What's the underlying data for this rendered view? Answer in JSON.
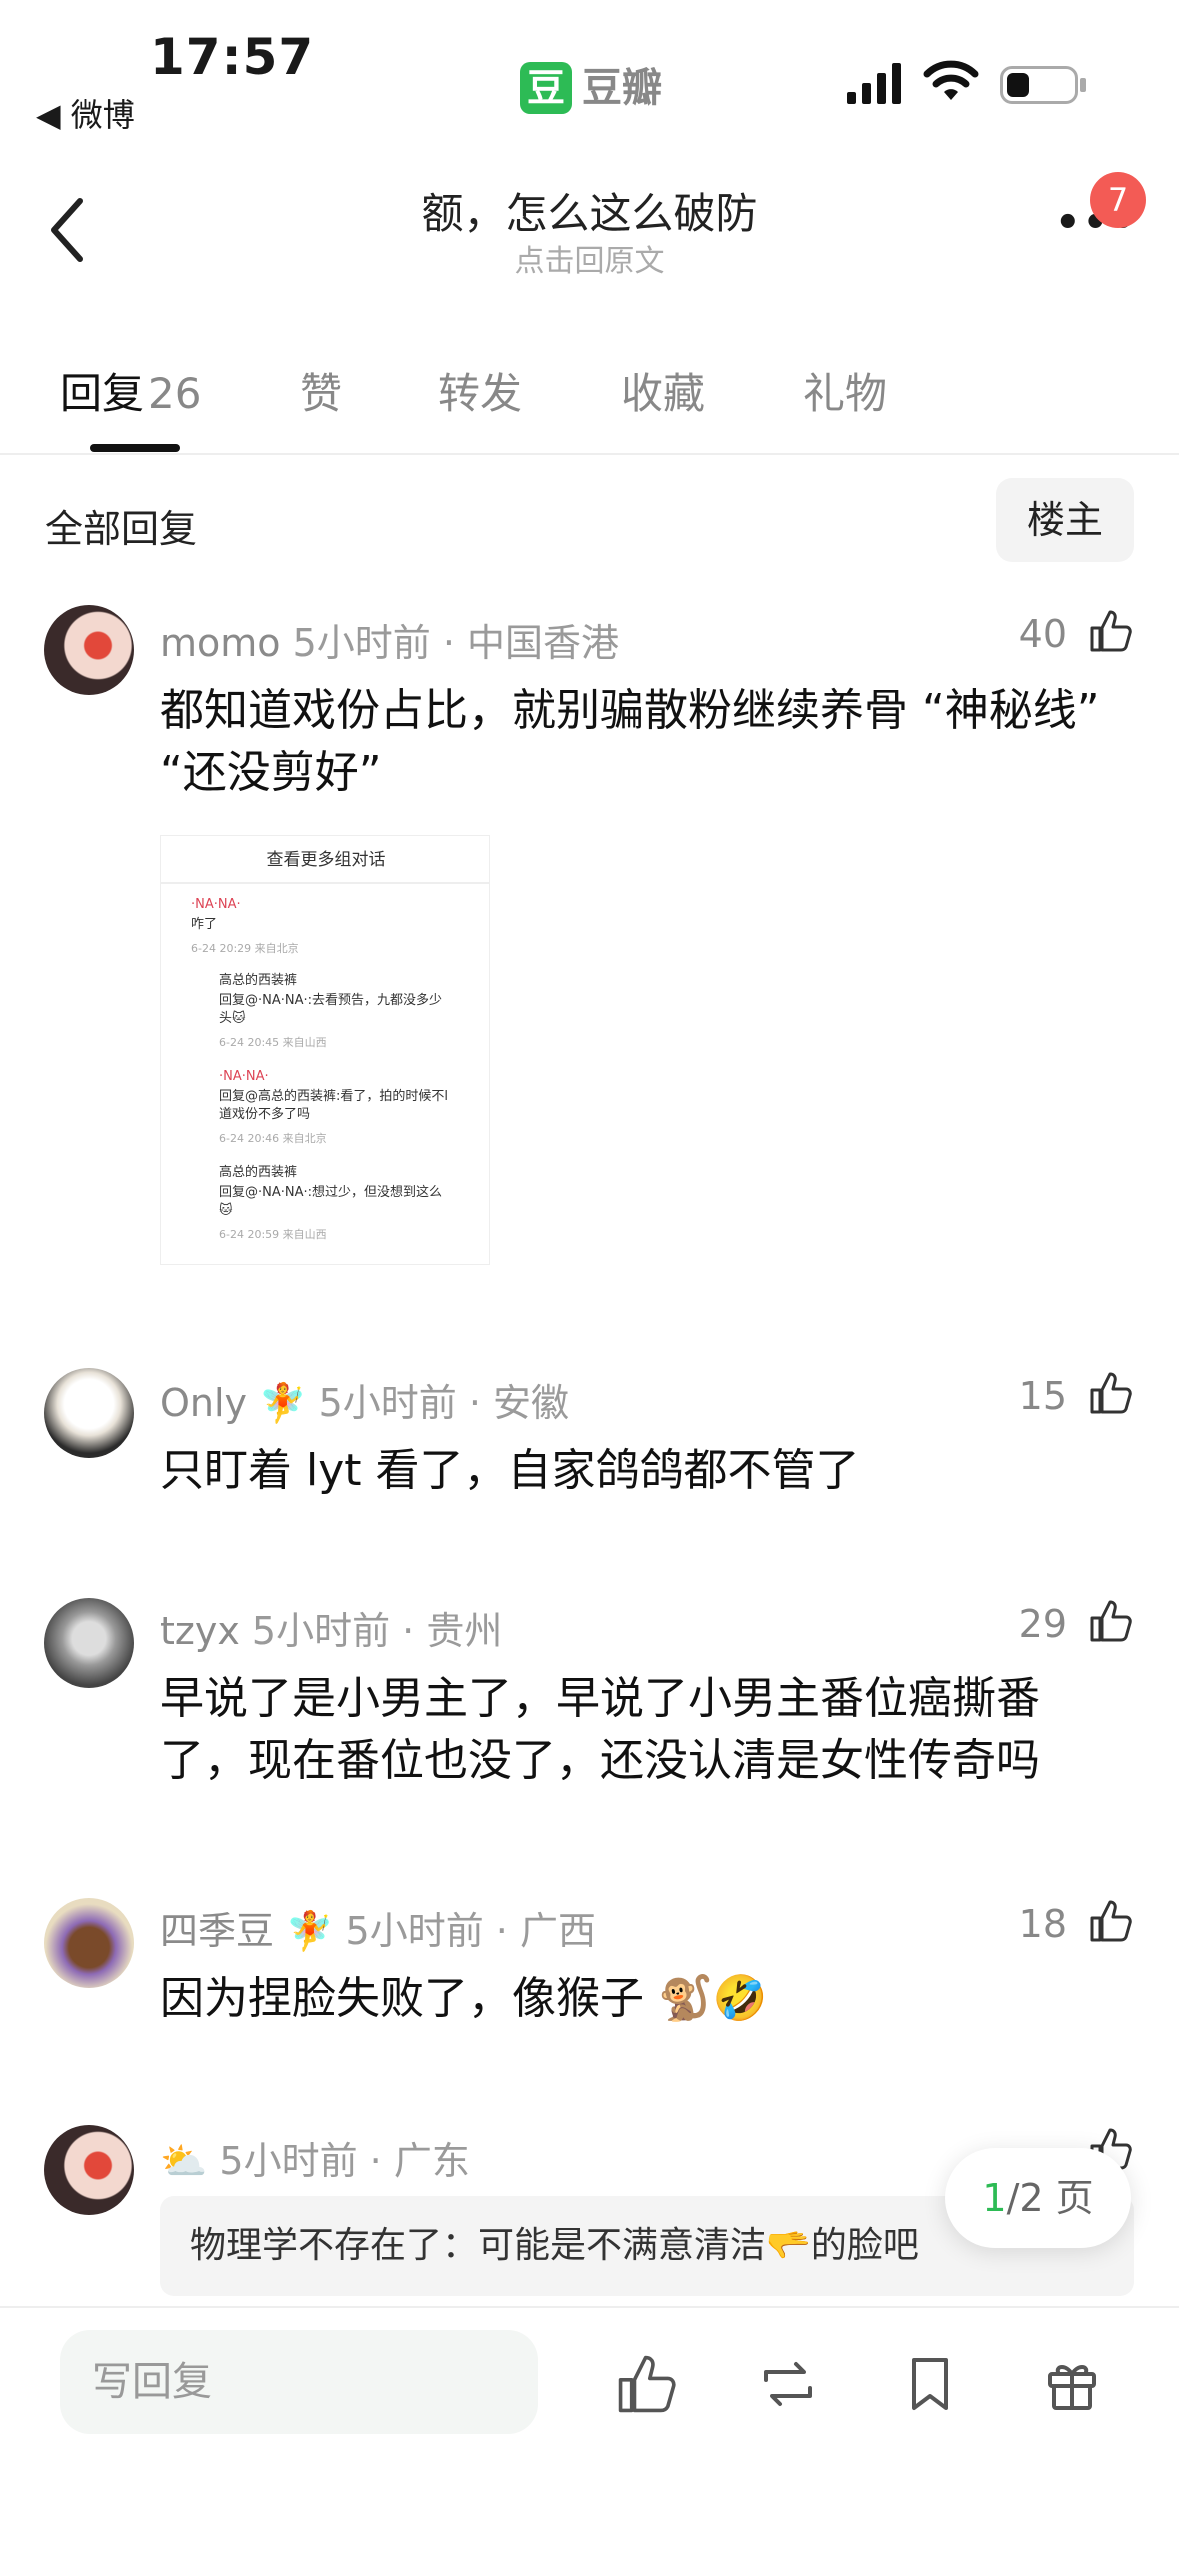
{
  "status_bar": {
    "time": "17:57",
    "back_app": "◀ 微博",
    "app_logo_char": "豆",
    "app_name": "豆瓣"
  },
  "nav": {
    "title": "额，怎么这么破防",
    "subtitle": "点击回原文",
    "more": "•••",
    "badge": "7"
  },
  "tabs": [
    {
      "label": "回复",
      "count": "26"
    },
    {
      "label": "赞"
    },
    {
      "label": "转发"
    },
    {
      "label": "收藏"
    },
    {
      "label": "礼物"
    }
  ],
  "section": {
    "title": "全部回复",
    "owner_button": "楼主"
  },
  "comments": [
    {
      "name": "momo",
      "meta": "5小时前 · 中国香港",
      "likes": "40",
      "text": "都知道戏份占比，就别骗散粉继续养骨 “神秘线” “还没剪好”"
    },
    {
      "name": "Only",
      "emoji": "🧚",
      "meta": "5小时前 · 安徽",
      "likes": "15",
      "text": "只盯着 lyt 看了，自家鸽鸽都不管了"
    },
    {
      "name": "tzyx",
      "meta": "5小时前 · 贵州",
      "likes": "29",
      "text": "早说了是小男主了，早说了小男主番位癌撕番了，现在番位也没了，还没认清是女性传奇吗"
    },
    {
      "name": "四季豆",
      "emoji": "🧚",
      "meta": "5小时前 · 广西",
      "likes": "18",
      "text": "因为捏脸失败了，像猴子 🐒🤣"
    },
    {
      "name": "⛅",
      "meta": "5小时前 · 广东",
      "likes": "",
      "quote": "物理学不存在了：可能是不满意清洁🫳的脸吧"
    }
  ],
  "attachment": {
    "header": "查看更多组对话",
    "rows": [
      {
        "user": "·NA·NA·",
        "text": "咋了",
        "meta": "6-24 20:29 来自北京"
      },
      {
        "user": "高总的西装裤",
        "text": "回复@·NA·NA·:去看预告，九都没多少",
        "text2": "头🐱",
        "meta": "6-24 20:45 来自山西"
      },
      {
        "user": "·NA·NA·",
        "text": "回复@高总的西装裤:看了，拍的时候不l",
        "text2": "道戏份不多了吗",
        "meta": "6-24 20:46 来自北京"
      },
      {
        "user": "高总的西装裤",
        "text": "回复@·NA·NA·:想过少，但没想到这么",
        "text2": "🐱",
        "meta": "6-24 20:59 来自山西"
      }
    ]
  },
  "pager": {
    "current": "1",
    "total_suffix": "/2 页"
  },
  "bottom": {
    "reply_placeholder": "写回复"
  },
  "colors": {
    "brand": "#2dbb55",
    "badge": "#f35b55"
  }
}
